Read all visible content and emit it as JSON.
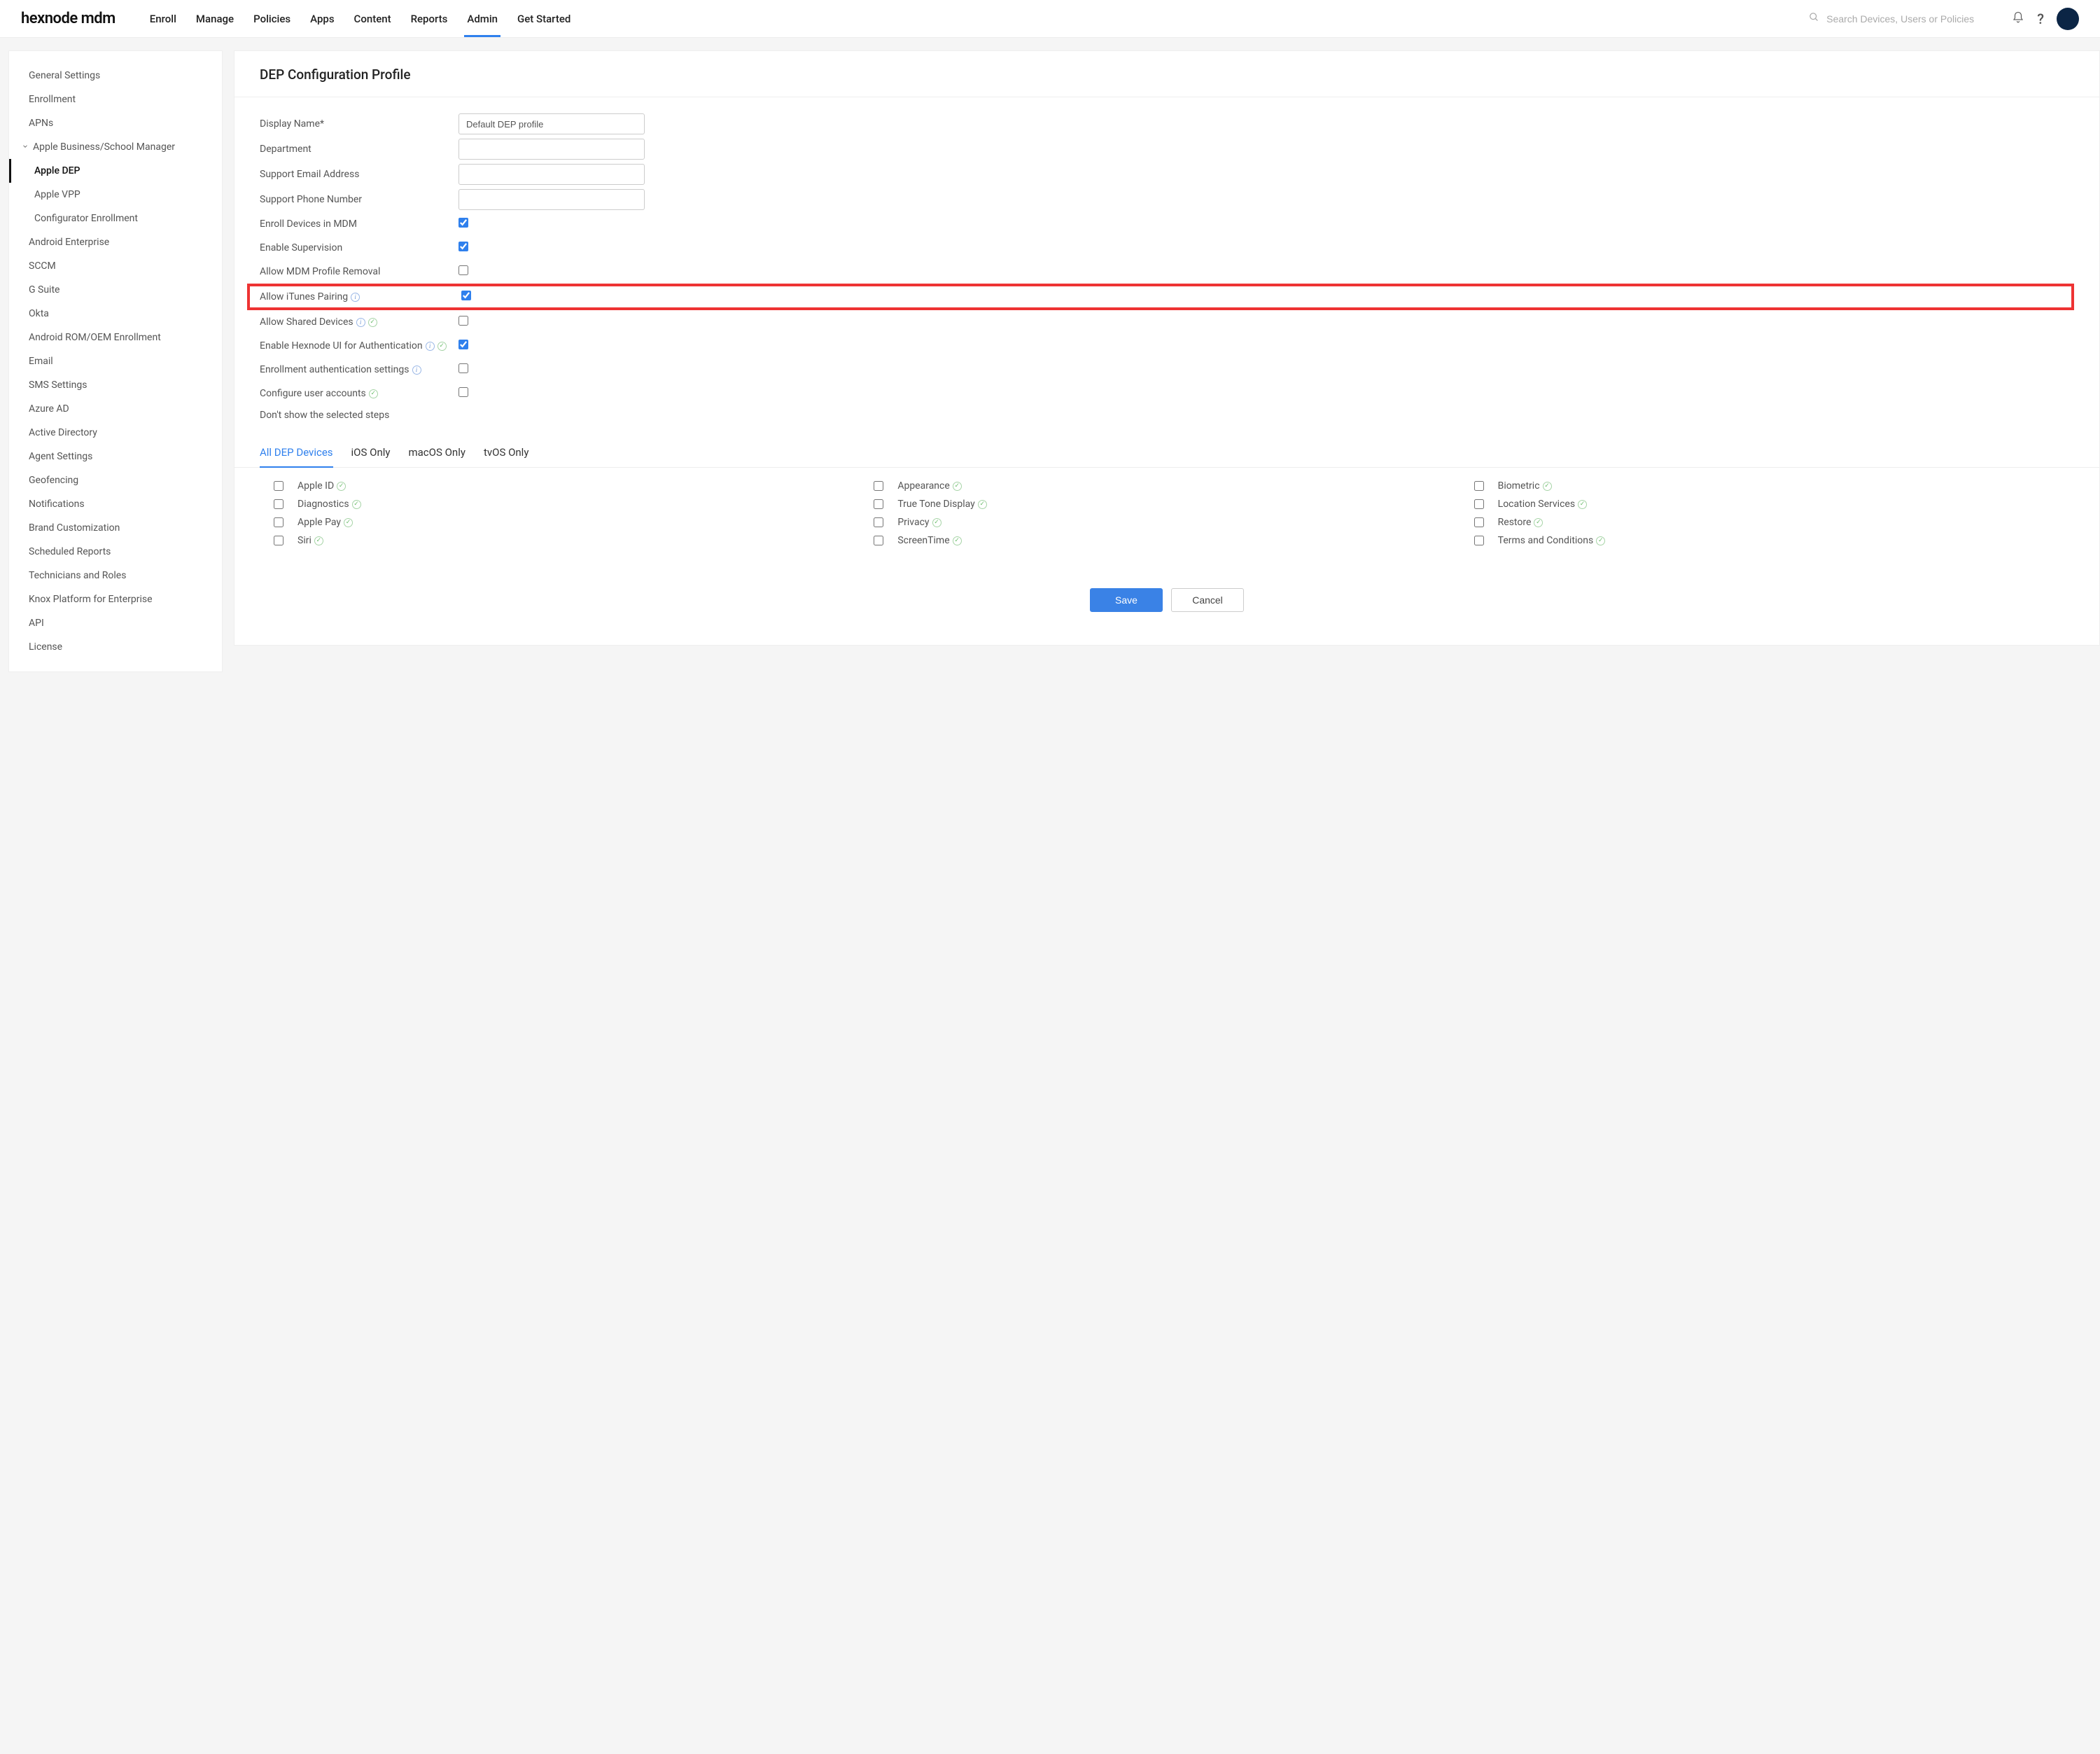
{
  "brand": "hexnode mdm",
  "nav": {
    "items": [
      "Enroll",
      "Manage",
      "Policies",
      "Apps",
      "Content",
      "Reports",
      "Admin",
      "Get Started"
    ],
    "activeIndex": 6
  },
  "search": {
    "placeholder": "Search Devices, Users or Policies"
  },
  "sidebar": {
    "items": [
      {
        "label": "General Settings"
      },
      {
        "label": "Enrollment"
      },
      {
        "label": "APNs"
      },
      {
        "label": "Apple Business/School Manager",
        "expandable": true,
        "expanded": true,
        "children": [
          {
            "label": "Apple DEP",
            "active": true
          },
          {
            "label": "Apple VPP"
          },
          {
            "label": "Configurator Enrollment"
          }
        ]
      },
      {
        "label": "Android Enterprise"
      },
      {
        "label": "SCCM"
      },
      {
        "label": "G Suite"
      },
      {
        "label": "Okta"
      },
      {
        "label": "Android ROM/OEM Enrollment"
      },
      {
        "label": "Email"
      },
      {
        "label": "SMS Settings"
      },
      {
        "label": "Azure AD"
      },
      {
        "label": "Active Directory"
      },
      {
        "label": "Agent Settings"
      },
      {
        "label": "Geofencing"
      },
      {
        "label": "Notifications"
      },
      {
        "label": "Brand Customization"
      },
      {
        "label": "Scheduled Reports"
      },
      {
        "label": "Technicians and Roles"
      },
      {
        "label": "Knox Platform for Enterprise"
      },
      {
        "label": "API"
      },
      {
        "label": "License"
      }
    ]
  },
  "main": {
    "title": "DEP Configuration Profile",
    "fields": {
      "display_name": {
        "label": "Display Name*",
        "value": "Default DEP profile"
      },
      "department": {
        "label": "Department",
        "value": ""
      },
      "support_email": {
        "label": "Support Email Address",
        "value": ""
      },
      "support_phone": {
        "label": "Support Phone Number",
        "value": ""
      },
      "enroll_mdm": {
        "label": "Enroll Devices in MDM",
        "checked": true
      },
      "enable_supervision": {
        "label": "Enable Supervision",
        "checked": true
      },
      "allow_profile_removal": {
        "label": "Allow MDM Profile Removal",
        "checked": false
      },
      "allow_itunes": {
        "label": "Allow iTunes Pairing",
        "checked": true,
        "info": true,
        "highlight": true
      },
      "allow_shared": {
        "label": "Allow Shared Devices",
        "checked": false,
        "info": true,
        "tick": true
      },
      "enable_hexnode_ui": {
        "label": "Enable Hexnode UI for Authentication",
        "checked": true,
        "info": true,
        "tick": true
      },
      "enroll_auth_settings": {
        "label": "Enrollment authentication settings",
        "checked": false,
        "info": true
      },
      "configure_user_accounts": {
        "label": "Configure user accounts",
        "checked": false,
        "tick": true
      },
      "dont_show_label": "Don't show the selected steps"
    },
    "steps_tabs": [
      "All DEP Devices",
      "iOS Only",
      "macOS Only",
      "tvOS Only"
    ],
    "steps_tabs_active": 0,
    "steps": [
      {
        "label": "Apple ID",
        "tick": true
      },
      {
        "label": "Appearance",
        "tick": true
      },
      {
        "label": "Biometric",
        "tick": true
      },
      {
        "label": "Diagnostics",
        "tick": true
      },
      {
        "label": "True Tone Display",
        "tick": true
      },
      {
        "label": "Location Services",
        "tick": true
      },
      {
        "label": "Apple Pay",
        "tick": true
      },
      {
        "label": "Privacy",
        "tick": true
      },
      {
        "label": "Restore",
        "tick": true
      },
      {
        "label": "Siri",
        "tick": true
      },
      {
        "label": "ScreenTime",
        "tick": true
      },
      {
        "label": "Terms and Conditions",
        "tick": true
      }
    ],
    "buttons": {
      "save": "Save",
      "cancel": "Cancel"
    }
  }
}
